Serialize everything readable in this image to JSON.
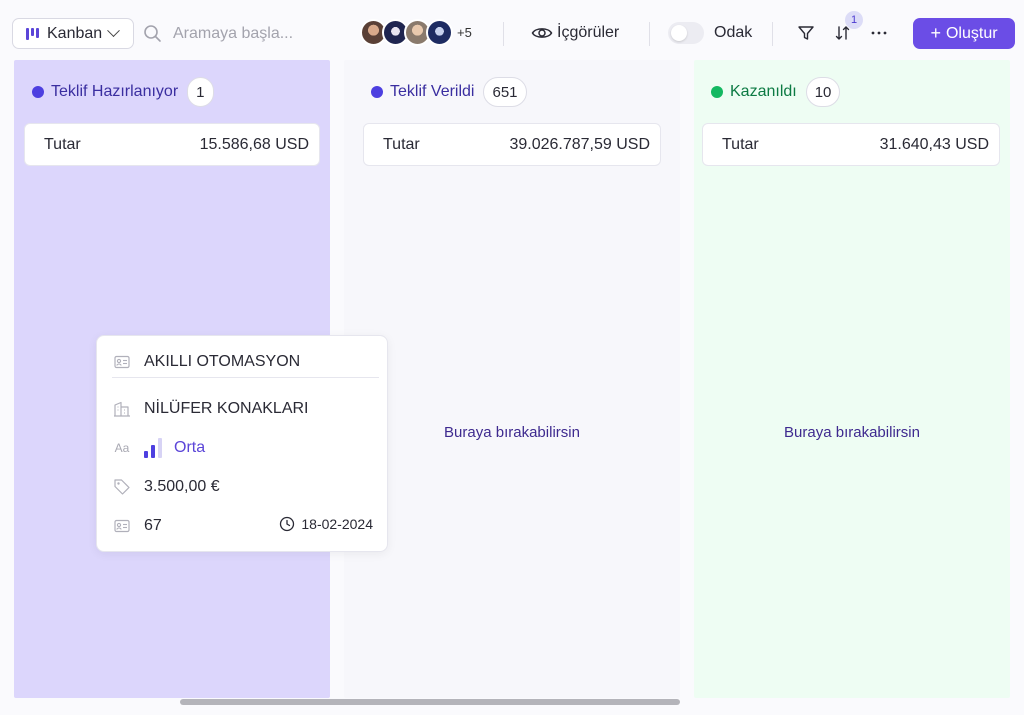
{
  "toolbar": {
    "view_label": "Kanban",
    "search_placeholder": "Aramaya başla...",
    "avatars_more": "+5",
    "insights_label": "İçgörüler",
    "focus_label": "Odak",
    "focus_on": false,
    "sort_badge": "1",
    "create_label": "Oluştur"
  },
  "colors": {
    "accent": "#6b4de6",
    "col1_bg": "#dcd6fc",
    "col3_bg": "#eefdf3",
    "dot_purple": "#4d3fe0",
    "dot_green": "#14b861"
  },
  "columns": [
    {
      "title": "Teklif Hazırlanıyor",
      "count": "1",
      "sum_label": "Tutar",
      "sum_value": "15.586,68 USD",
      "drop_hint": ""
    },
    {
      "title": "Teklif Verildi",
      "count": "651",
      "sum_label": "Tutar",
      "sum_value": "39.026.787,59 USD",
      "drop_hint": "Buraya bırakabilirsin"
    },
    {
      "title": "Kazanıldı",
      "count": "10",
      "sum_label": "Tutar",
      "sum_value": "31.640,43 USD",
      "drop_hint": "Buraya bırakabilirsin"
    }
  ],
  "card": {
    "title": "AKILLI OTOMASYON",
    "company": "NİLÜFER KONAKLARI",
    "priority": "Orta",
    "amount": "3.500,00 €",
    "id": "67",
    "date": "18-02-2024"
  }
}
